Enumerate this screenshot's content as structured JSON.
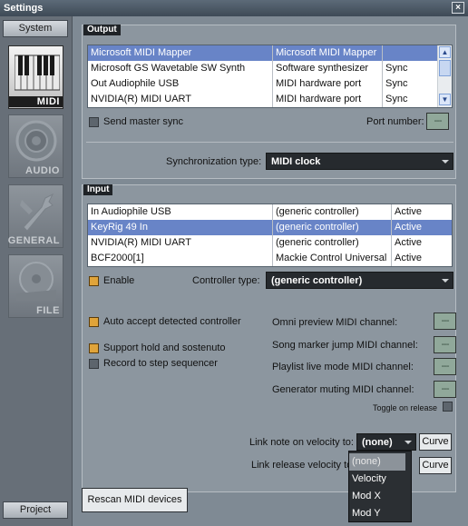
{
  "window": {
    "title": "Settings",
    "close_glyph": "×"
  },
  "sidebar": {
    "top_button": "System",
    "bottom_button": "Project",
    "categories": [
      {
        "label": "MIDI",
        "icon": "piano-keys-icon",
        "active": true
      },
      {
        "label": "AUDIO",
        "icon": "speaker-icon",
        "active": false
      },
      {
        "label": "GENERAL",
        "icon": "wrench-icon",
        "active": false
      },
      {
        "label": "FILE",
        "icon": "disk-icon",
        "active": false
      }
    ]
  },
  "output": {
    "title": "Output",
    "rows": [
      {
        "name": "Microsoft MIDI Mapper",
        "type": "Microsoft MIDI Mapper",
        "status": ""
      },
      {
        "name": "Microsoft GS Wavetable SW Synth",
        "type": "Software synthesizer",
        "status": "Sync"
      },
      {
        "name": "Out Audiophile USB",
        "type": "MIDI hardware port",
        "status": "Sync"
      },
      {
        "name": "NVIDIA(R) MIDI UART",
        "type": "MIDI hardware port",
        "status": "Sync"
      }
    ],
    "send_master_sync": "Send master sync",
    "port_number_label": "Port number:",
    "port_number_value": "---",
    "sync_type_label": "Synchronization type:",
    "sync_type_value": "MIDI clock"
  },
  "input": {
    "title": "Input",
    "rows": [
      {
        "name": "In Audiophile USB",
        "type": "(generic controller)",
        "status": "Active"
      },
      {
        "name": "KeyRig 49 In",
        "type": "(generic controller)",
        "status": "Active"
      },
      {
        "name": "NVIDIA(R) MIDI UART",
        "type": "(generic controller)",
        "status": "Active"
      },
      {
        "name": "BCF2000[1]",
        "type": "Mackie Control Universal",
        "status": "Active"
      }
    ],
    "enable_label": "Enable",
    "controller_type_label": "Controller type:",
    "controller_type_value": "(generic controller)"
  },
  "options": {
    "auto_accept": "Auto accept detected controller",
    "support_hold": "Support hold and sostenuto",
    "record_step": "Record to step sequencer",
    "omni_preview": "Omni preview MIDI channel:",
    "song_marker": "Song marker jump MIDI channel:",
    "playlist_live": "Playlist live mode MIDI channel:",
    "generator_muting": "Generator muting MIDI channel:",
    "lcd_value": "---",
    "toggle_on_release": "Toggle on release",
    "link_note_label": "Link note on velocity to:",
    "link_note_value": "(none)",
    "link_release_label": "Link release velocity to:",
    "curve_label": "Curve",
    "dropdown_options": [
      "(none)",
      "Velocity",
      "Mod X",
      "Mod Y"
    ]
  },
  "rescan_button": "Rescan MIDI devices",
  "colors": {
    "accent_checkbox": "#e0a43a",
    "selection": "#6884c7"
  }
}
